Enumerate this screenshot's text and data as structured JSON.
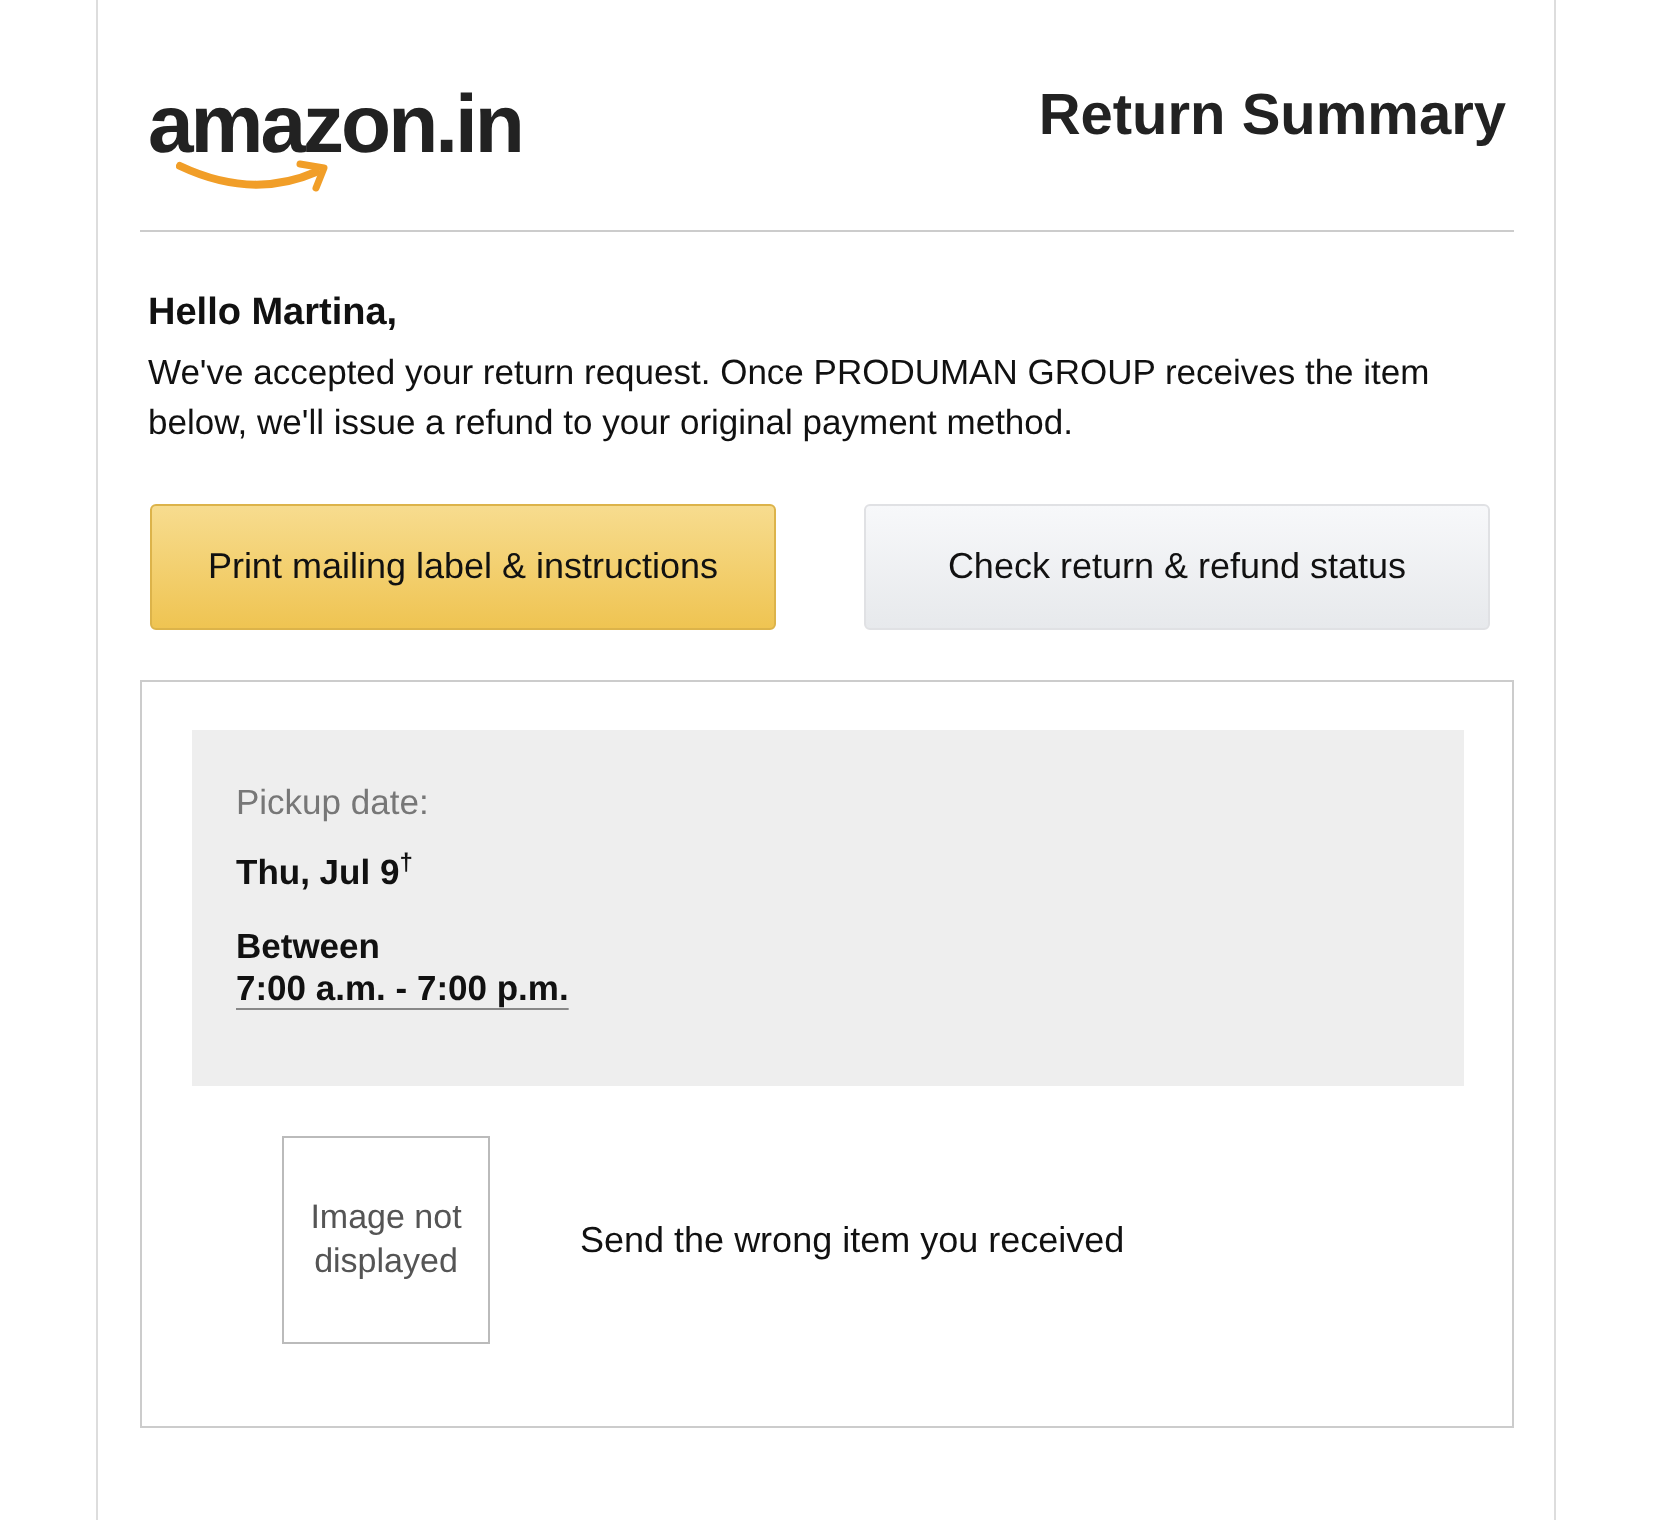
{
  "header": {
    "logo": "amazon.in",
    "title": "Return Summary"
  },
  "greeting": "Hello Martina,",
  "message": "We've accepted your return request. Once PRODUMAN GROUP receives the item below, we'll issue a refund to your original payment method.",
  "buttons": [
    {
      "label": "Print mailing label & instructions",
      "kind": "primary"
    },
    {
      "label": "Check return & refund status",
      "kind": "secondary"
    }
  ],
  "pickup": {
    "label": "Pickup date:",
    "date": "Thu, Jul 9$^{†}$",
    "window_label": "Between",
    "window": "7:00 a.m. - 7:00 p.m."
  },
  "item": {
    "image_text": "Image not displayed",
    "reason": "Send the wrong item you received"
  }
}
